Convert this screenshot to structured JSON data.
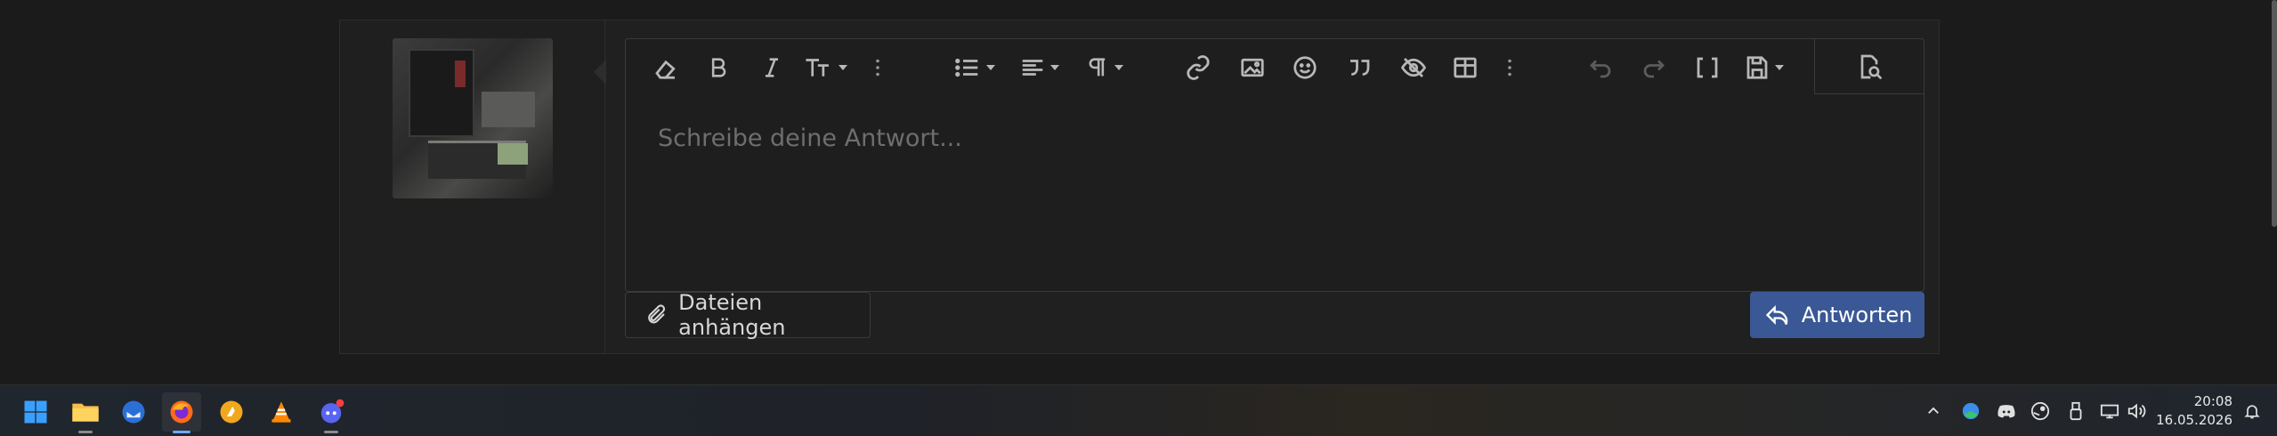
{
  "editor": {
    "placeholder": "Schreibe deine Antwort...",
    "toolbar": {
      "tools": [
        "eraser-icon",
        "bold-icon",
        "italic-icon",
        "text-size-icon",
        "more-vertical-icon",
        "list-icon",
        "align-icon",
        "paragraph-icon",
        "link-icon",
        "image-icon",
        "emoji-icon",
        "quote-icon",
        "hide-icon",
        "table-icon",
        "more-vertical-icon",
        "undo-icon",
        "redo-icon",
        "bbcode-icon",
        "save-icon",
        "preview-icon"
      ]
    }
  },
  "actions": {
    "attach_label": "Dateien anhängen",
    "reply_label": "Antworten",
    "reply_color": "#3a5895"
  },
  "taskbar": {
    "apps": [
      "start-icon",
      "file-explorer-icon",
      "thunderbird-icon",
      "firefox-icon",
      "app-icon",
      "vlc-icon",
      "discord-icon"
    ],
    "tray": [
      "chevron-up-icon",
      "browser-icon",
      "discord-icon",
      "steam-icon",
      "usb-icon",
      "network-icon",
      "volume-icon"
    ],
    "time": "20:08",
    "date": "16.05.2026"
  }
}
